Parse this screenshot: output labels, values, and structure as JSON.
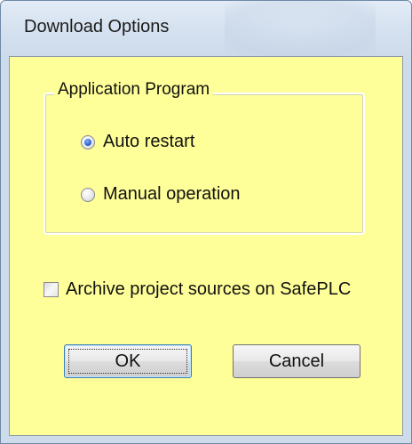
{
  "window": {
    "title": "Download Options"
  },
  "group": {
    "title": "Application Program",
    "options": [
      {
        "label": "Auto restart",
        "selected": true
      },
      {
        "label": "Manual operation",
        "selected": false
      }
    ]
  },
  "archive": {
    "label": "Archive project sources on SafePLC",
    "checked": false
  },
  "buttons": {
    "ok_label": "OK",
    "cancel_label": "Cancel"
  },
  "colors": {
    "client_background": "#ffff99",
    "titlebar": "#d6e2f0",
    "default_button_border": "#3c7fb1"
  }
}
